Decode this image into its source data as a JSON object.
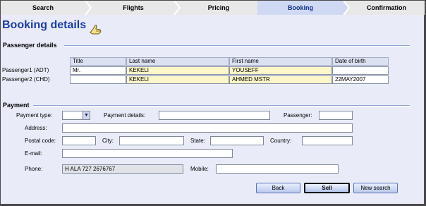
{
  "steps": [
    "Search",
    "Flights",
    "Pricing",
    "Booking",
    "Confirmation"
  ],
  "active_step": "Booking",
  "page_title": "Booking details",
  "passenger_section": {
    "title": "Passenger details",
    "columns": [
      "Title",
      "Last name",
      "First name",
      "Date of birth"
    ],
    "rows": [
      {
        "label": "Passenger1 (ADT)",
        "title": "Mr.",
        "last_name": "KEKELI",
        "first_name": "YOUSEFF",
        "dob": ""
      },
      {
        "label": "Passenger2 (CHD)",
        "title": "",
        "last_name": "KEKELI",
        "first_name": "AHMED MSTR",
        "dob": "22MAY2007"
      }
    ]
  },
  "payment_section": {
    "title": "Payment",
    "payment_type_label": "Payment type:",
    "payment_type_value": "",
    "payment_details_label": "Payment details:",
    "payment_details_value": "",
    "passenger_label": "Passenger:",
    "passenger_value": "",
    "address_label": "Address:",
    "address_value": "",
    "postal_code_label": "Postal code:",
    "postal_code_value": "",
    "city_label": "City:",
    "city_value": "",
    "state_label": "State:",
    "state_value": "",
    "country_label": "Country:",
    "country_value": "",
    "email_label": "E-mail:",
    "email_value": "",
    "phone_label": "Phone:",
    "phone_value": "H ALA 727 2676767",
    "mobile_label": "Mobile:",
    "mobile_value": ""
  },
  "buttons": {
    "back": "Back",
    "sell": "Sell",
    "new_search": "New search"
  },
  "colors": {
    "accent": "#1a3dab",
    "active_step_bg": "#cfd9f3",
    "highlight_cell": "#fcf7c8"
  }
}
